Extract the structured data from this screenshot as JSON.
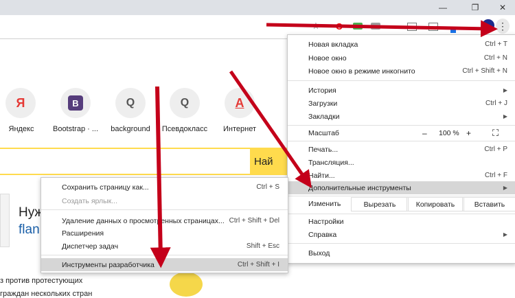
{
  "titlebar": {
    "minimize": "—",
    "restore": "❐",
    "close": "✕"
  },
  "toolbar": {
    "star": "☆",
    "opera": "O",
    "menu_dots": "⋮"
  },
  "tiles": [
    {
      "letter": "Я",
      "label": "Яндекс",
      "color": "#e53935"
    },
    {
      "letter": "B",
      "label": "Bootstrap · ...",
      "color": "#563d7c"
    },
    {
      "letter": "Q",
      "label": "background",
      "color": "#555555"
    },
    {
      "letter": "Q",
      "label": "Псевдокласс",
      "color": "#555555"
    },
    {
      "letter": "A",
      "label": "Интернет",
      "color": "#e53935"
    }
  ],
  "search": {
    "button_text": "Най"
  },
  "news": {
    "title_fragment": "Нуж",
    "link_fragment": "flan",
    "line1": "з против протестующих",
    "line2": "граждан нескольких стран"
  },
  "main_menu": {
    "new_tab": "Новая вкладка",
    "new_tab_sc": "Ctrl + T",
    "new_window": "Новое окно",
    "new_window_sc": "Ctrl + N",
    "incognito": "Новое окно в режиме инкогнито",
    "incognito_sc": "Ctrl + Shift + N",
    "history": "История",
    "downloads": "Загрузки",
    "downloads_sc": "Ctrl + J",
    "bookmarks": "Закладки",
    "zoom_label": "Масштаб",
    "zoom_minus": "–",
    "zoom_value": "100 %",
    "zoom_plus": "+",
    "fullscreen": "⛶",
    "print": "Печать...",
    "print_sc": "Ctrl + P",
    "cast": "Трансляция...",
    "find": "Найти...",
    "find_sc": "Ctrl + F",
    "more_tools": "Дополнительные инструменты",
    "edit": "Изменить",
    "cut": "Вырезать",
    "copy": "Копировать",
    "paste": "Вставить",
    "settings": "Настройки",
    "help": "Справка",
    "exit": "Выход"
  },
  "sub_menu": {
    "save_page": "Сохранить страницу как...",
    "save_page_sc": "Ctrl + S",
    "create_shortcut": "Создать ярлык...",
    "clear_data": "Удаление данных о просмотренных страницах...",
    "clear_data_sc": "Ctrl + Shift + Del",
    "extensions": "Расширения",
    "task_manager": "Диспетчер задач",
    "task_manager_sc": "Shift + Esc",
    "dev_tools": "Инструменты разработчика",
    "dev_tools_sc": "Ctrl + Shift + I"
  },
  "colors": {
    "accent_arrow": "#c4001a",
    "search_yellow": "#ffdb4d",
    "highlight": "#d6d6d6"
  }
}
